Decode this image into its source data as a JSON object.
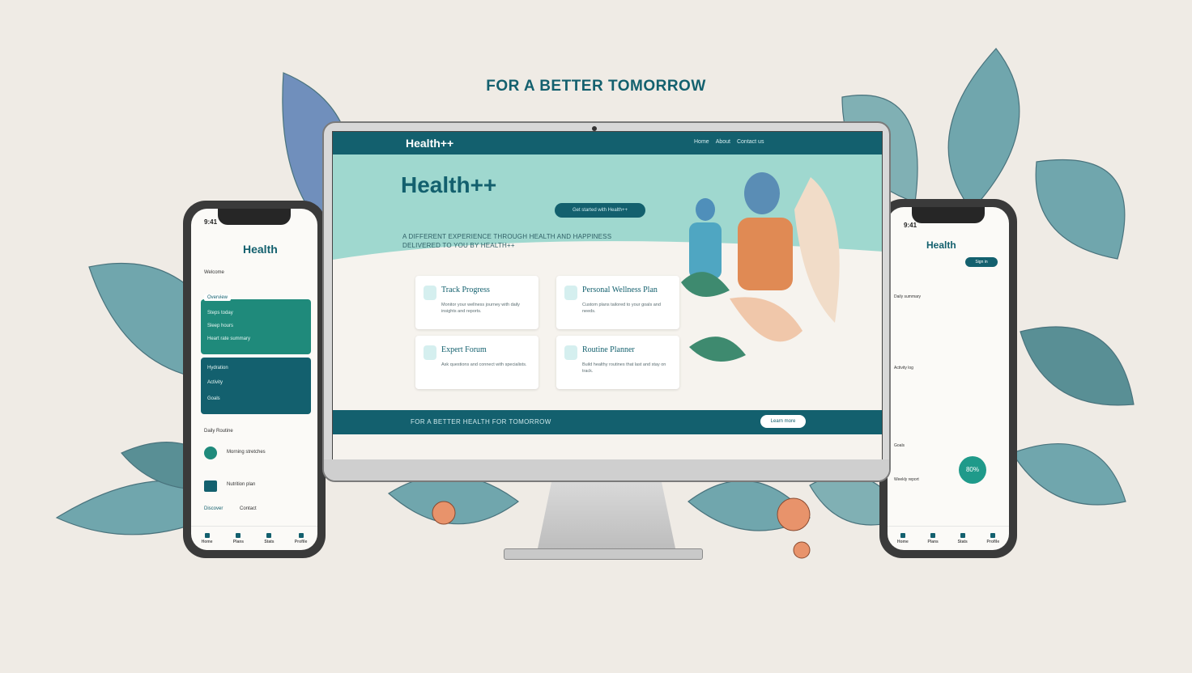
{
  "tagline": "FOR A BETTER TOMORROW",
  "colors": {
    "brand": "#13606e",
    "accent": "#9fd8cf",
    "green": "#1f8a7b",
    "flower": "#e8936b"
  },
  "desktop": {
    "nav": {
      "logo": "Health++",
      "links": [
        "Home",
        "About",
        "Contact us"
      ]
    },
    "hero": {
      "title": "Health++",
      "cta": "Get started with Health++",
      "subtitle": "A DIFFERENT EXPERIENCE THROUGH HEALTH AND HAPPINESS DELIVERED TO YOU BY HEALTH++"
    },
    "cards": [
      {
        "icon": "heart-icon",
        "title": "Track Progress",
        "text": "Monitor your wellness journey with daily insights and reports."
      },
      {
        "icon": "people-icon",
        "title": "Personal Wellness Plan",
        "text": "Custom plans tailored to your goals and needs."
      },
      {
        "icon": "leaf-icon",
        "title": "Expert Forum",
        "text": "Ask questions and connect with specialists."
      },
      {
        "icon": "chart-icon",
        "title": "Routine Planner",
        "text": "Build healthy routines that last and stay on track."
      }
    ],
    "footer": {
      "text": "FOR A BETTER HEALTH FOR TOMORROW",
      "button": "Learn more"
    }
  },
  "left_phone": {
    "time": "9:41",
    "logo": "Health",
    "section1": "Welcome",
    "card_header": "Overview",
    "card_rows": [
      "Steps today",
      "Sleep hours",
      "Heart rate summary",
      "Hydration"
    ],
    "card2_rows": [
      "Activity",
      "Goals"
    ],
    "list_title": "Daily Routine",
    "list_items": [
      "Morning stretches",
      "Nutrition plan"
    ],
    "links": [
      "Discover",
      "Contact"
    ],
    "tabs": [
      "Home",
      "Plans",
      "Stats",
      "Profile"
    ]
  },
  "right_phone": {
    "time": "9:41",
    "logo": "Health",
    "button": "Sign in",
    "rows": [
      "Daily summary",
      "Activity log",
      "Goals",
      "Weekly report"
    ],
    "circle": "80%",
    "tabs": [
      "Home",
      "Plans",
      "Stats",
      "Profile"
    ]
  }
}
